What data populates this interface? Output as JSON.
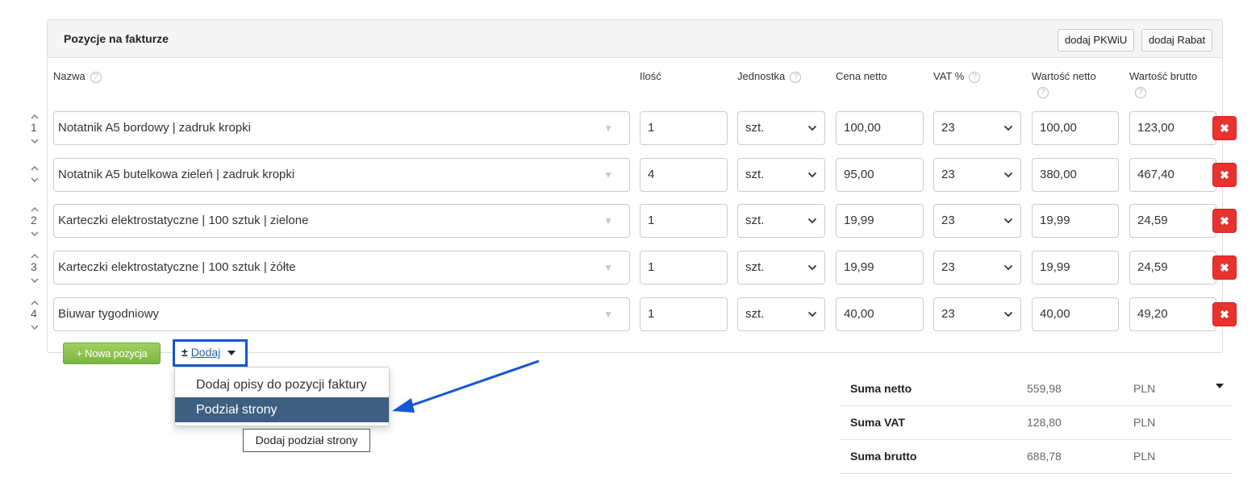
{
  "panel": {
    "title": "Pozycje na fakturze",
    "buttons": {
      "pkwiu": "dodaj PKWiU",
      "rabat": "dodaj Rabat"
    }
  },
  "columns": {
    "nazwa": "Nazwa",
    "ilosc": "Ilość",
    "jednostka": "Jednostka",
    "cena_netto": "Cena netto",
    "vat": "VAT %",
    "wartosc_netto": "Wartość netto",
    "wartosc_brutto": "Wartość brutto",
    "help_glyph": "?"
  },
  "order": {
    "up_glyph": "^",
    "down_glyph": "v"
  },
  "rows": [
    {
      "order": "1",
      "name": "Notatnik A5 bordowy | zadruk kropki",
      "qty": "1",
      "unit": "szt.",
      "price_net": "100,00",
      "vat": "23",
      "value_net": "100,00",
      "value_gross": "123,00"
    },
    {
      "order": "",
      "name": "Notatnik A5 butelkowa zieleń | zadruk kropki",
      "qty": "4",
      "unit": "szt.",
      "price_net": "95,00",
      "vat": "23",
      "value_net": "380,00",
      "value_gross": "467,40"
    },
    {
      "order": "2",
      "name": "Karteczki elektrostatyczne | 100 sztuk | zielone",
      "qty": "1",
      "unit": "szt.",
      "price_net": "19,99",
      "vat": "23",
      "value_net": "19,99",
      "value_gross": "24,59"
    },
    {
      "order": "3",
      "name": "Karteczki elektrostatyczne | 100 sztuk | żółte",
      "qty": "1",
      "unit": "szt.",
      "price_net": "19,99",
      "vat": "23",
      "value_net": "19,99",
      "value_gross": "24,59"
    },
    {
      "order": "4",
      "name": "Biuwar tygodniowy",
      "qty": "1",
      "unit": "szt.",
      "price_net": "40,00",
      "vat": "23",
      "value_net": "40,00",
      "value_gross": "49,20"
    }
  ],
  "delete_glyph": "✖",
  "name_dropdown_glyph": "▼",
  "actions": {
    "new_position": "+ Nowa pozycja",
    "dodaj_plus": "±",
    "dodaj_label": "Dodaj"
  },
  "dropdown_menu": {
    "items": [
      "Dodaj opisy do pozycji faktury",
      "Podział strony"
    ],
    "active_index": 1
  },
  "tooltip": "Dodaj podział strony",
  "summary": [
    {
      "label": "Suma netto",
      "value": "559,98",
      "currency": "PLN"
    },
    {
      "label": "Suma VAT",
      "value": "128,80",
      "currency": "PLN"
    },
    {
      "label": "Suma brutto",
      "value": "688,78",
      "currency": "PLN"
    }
  ],
  "colors": {
    "accent_blue": "#1556d6",
    "delete_red": "#e9322d",
    "new_green": "#8bc34a",
    "menu_active": "#3e5f80"
  }
}
